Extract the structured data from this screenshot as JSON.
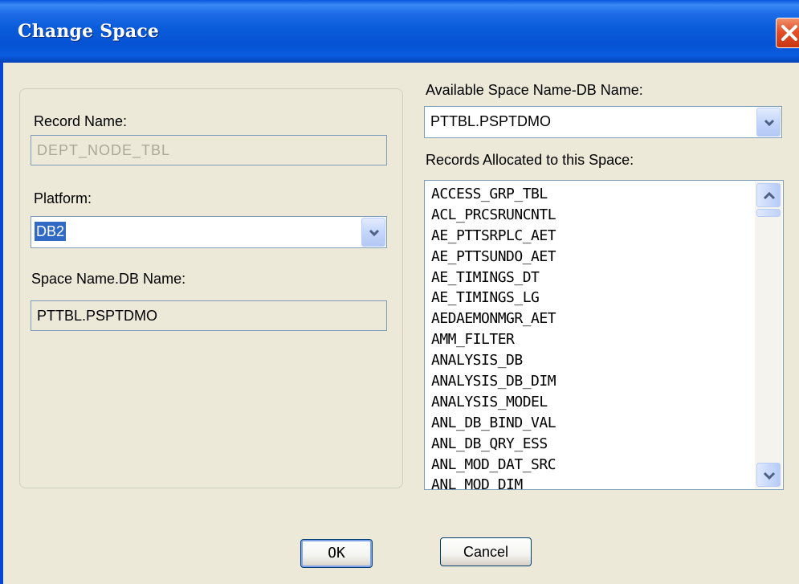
{
  "window": {
    "title": "Change Space"
  },
  "left": {
    "record_name_label": "Record Name:",
    "record_name_value": "DEPT_NODE_TBL",
    "platform_label": "Platform:",
    "platform_value": "DB2",
    "space_name_label": "Space Name.DB Name:",
    "space_name_value": "PTTBL.PSPTDMO"
  },
  "right": {
    "available_label": "Available Space Name-DB Name:",
    "available_value": "PTTBL.PSPTDMO",
    "records_label": "Records Allocated to this Space:",
    "records": [
      "ACCESS_GRP_TBL",
      "ACL_PRCSRUNCNTL",
      "AE_PTTSRPLC_AET",
      "AE_PTTSUNDO_AET",
      "AE_TIMINGS_DT",
      "AE_TIMINGS_LG",
      "AEDAEMONMGR_AET",
      "AMM_FILTER",
      "ANALYSIS_DB",
      "ANALYSIS_DB_DIM",
      "ANALYSIS_MODEL",
      "ANL_DB_BIND_VAL",
      "ANL_DB_QRY_ESS",
      "ANL_MOD_DAT_SRC",
      "ANL_MOD_DIM"
    ]
  },
  "buttons": {
    "ok": "OK",
    "cancel": "Cancel"
  },
  "icons": {
    "close": "close-icon",
    "dropdown": "chevron-down-icon",
    "scroll_up": "chevron-up-icon",
    "scroll_down": "chevron-down-icon"
  },
  "colors": {
    "titlebar": "#0a5cda",
    "dialog_bg": "#ece9d8",
    "close": "#e24f28",
    "selection": "#316ac5"
  }
}
